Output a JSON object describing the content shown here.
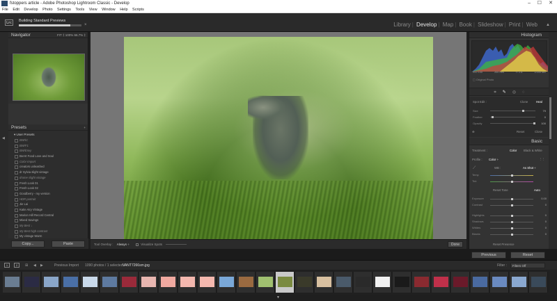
{
  "window": {
    "title": "fstoppers article - Adobe Photoshop Lightroom Classic - Develop",
    "minimize": "–",
    "maximize": "☐",
    "close": "✕"
  },
  "menu": [
    "File",
    "Edit",
    "Develop",
    "Photo",
    "Settings",
    "Tools",
    "View",
    "Window",
    "Help",
    "Scripts"
  ],
  "identity": {
    "logo": "Lrc",
    "progress_title": "Building Standard Previews",
    "progress_fraction": 0.82,
    "cancel": "×"
  },
  "modules": [
    {
      "label": "Library",
      "active": false
    },
    {
      "label": "Develop",
      "active": true
    },
    {
      "label": "Map",
      "active": false
    },
    {
      "label": "Book",
      "active": false
    },
    {
      "label": "Slideshow",
      "active": false
    },
    {
      "label": "Print",
      "active": false
    },
    {
      "label": "Web",
      "active": false
    }
  ],
  "navigator": {
    "title": "Navigator",
    "zoom_options": "FIT ‡ 100% 66.7% ‡"
  },
  "presets": {
    "title": "Presets",
    "folder": "User Presets",
    "items": [
      {
        "label": "BW/IC",
        "dim": true
      },
      {
        "label": "BW/F1",
        "dim": true
      },
      {
        "label": "BW/Envy",
        "dim": true
      },
      {
        "label": "BeArt Food Love and Soul",
        "dim": false
      },
      {
        "label": "Color Import",
        "dim": true
      },
      {
        "label": "creators unleashed",
        "dim": false
      },
      {
        "label": "dr Sylvia slight vintage",
        "dim": false
      },
      {
        "label": "drome slight vintage",
        "dim": true
      },
      {
        "label": "Fresh Look 01",
        "dim": false
      },
      {
        "label": "Fresh Look 02",
        "dim": false
      },
      {
        "label": "Goodberry - my version",
        "dim": false
      },
      {
        "label": "HDR portrait",
        "dim": true
      },
      {
        "label": "Jie Lai",
        "dim": false
      },
      {
        "label": "Katie Airy Vintage",
        "dim": false
      },
      {
        "label": "Marion Hill Record Central",
        "dim": false
      },
      {
        "label": "Mixed Savings",
        "dim": false
      },
      {
        "label": "My Best ↓",
        "dim": true
      },
      {
        "label": "My Best high contrast",
        "dim": true
      },
      {
        "label": "My vintage Warm",
        "dim": false
      },
      {
        "label": "OCR",
        "dim": false
      }
    ],
    "copy_label": "Copy...",
    "paste_label": "Paste"
  },
  "toolbar": {
    "tool_overlay_label": "Tool Overlay :",
    "tool_overlay_value": "Always ÷",
    "visualize_spots": "Visualize Spots",
    "done": "Done"
  },
  "histogram": {
    "title": "Histogram",
    "iso": "ISO 100",
    "focal": "200 mm",
    "aperture": "f / 2.8",
    "shutter": "1/200 sec",
    "original_photo": "Original Photo"
  },
  "heal": {
    "label": "Spot Edit :",
    "clone": "Clone",
    "heal": "Heal",
    "size_label": "Size",
    "size_value": "79",
    "feather_label": "Feather",
    "feather_value": "0",
    "opacity_label": "Opacity",
    "opacity_value": "100",
    "reset": "Reset",
    "close": "Close"
  },
  "basic": {
    "title": "Basic",
    "treatment": "Treatment :",
    "color": "Color",
    "bw": "Black & White",
    "profile": "Profile :",
    "profile_value": "Color ÷",
    "wb_label": "WB :",
    "wb_value": "As Shot ÷",
    "temp": "Temp",
    "tint": "Tint",
    "tone": "Reset Tone",
    "auto": "Auto",
    "exposure": "Exposure",
    "exposure_value": "0.00",
    "contrast": "Contrast",
    "contrast_value": "0",
    "highlights": "Highlights",
    "highlights_value": "0",
    "shadows": "Shadows",
    "shadows_value": "0",
    "whites": "Whites",
    "whites_value": "0",
    "blacks": "Blacks",
    "blacks_value": "0",
    "presence": "Reset Presence",
    "previous": "Previous",
    "reset_btn": "Reset"
  },
  "filmstrip": {
    "page1": "1",
    "page2": "2",
    "source": "Previous Import",
    "count": "1090 photos / 1 selected /",
    "filename": "VANT7266sm.jpg",
    "filter_label": "Filter :",
    "filter_value": "Filters Off"
  }
}
